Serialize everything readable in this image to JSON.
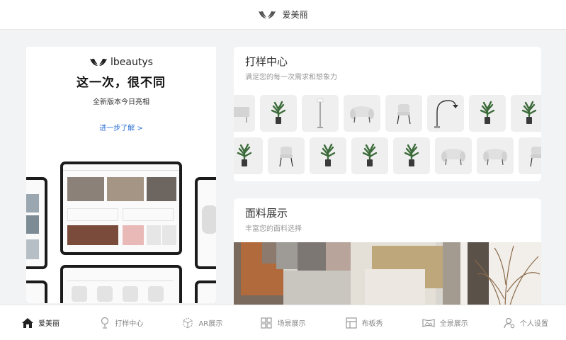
{
  "header": {
    "title": "爱美丽",
    "logo_icon": "wing-logo-icon"
  },
  "promo": {
    "brand": "lbeautys",
    "headline": "这一次，很不同",
    "subtitle": "全新版本今日亮相",
    "more_link": "进一步了解 >"
  },
  "sample_center": {
    "title": "打样中心",
    "subtitle": "满足您的每一次需求和想象力",
    "row1": [
      "table",
      "plant",
      "floor-lamp",
      "armchair",
      "chair",
      "arc-lamp",
      "plant",
      "plant"
    ],
    "row2": [
      "plant",
      "chair",
      "plant",
      "plant",
      "plant",
      "armchair",
      "armchair",
      "chair"
    ]
  },
  "fabric": {
    "title": "面料展示",
    "subtitle": "丰富您的面料选择"
  },
  "tabs": [
    {
      "label": "爱美丽",
      "icon": "home-icon",
      "active": true
    },
    {
      "label": "打样中心",
      "icon": "lamp-icon",
      "active": false
    },
    {
      "label": "AR展示",
      "icon": "ar-cube-icon",
      "active": false
    },
    {
      "label": "场景展示",
      "icon": "grid-icon",
      "active": false
    },
    {
      "label": "布板秀",
      "icon": "panel-icon",
      "active": false
    },
    {
      "label": "全景展示",
      "icon": "panorama-icon",
      "active": false
    },
    {
      "label": "个人设置",
      "icon": "user-settings-icon",
      "active": false
    }
  ],
  "colors": {
    "accent_link": "#2a6fd6",
    "background": "#f2f3f5"
  }
}
